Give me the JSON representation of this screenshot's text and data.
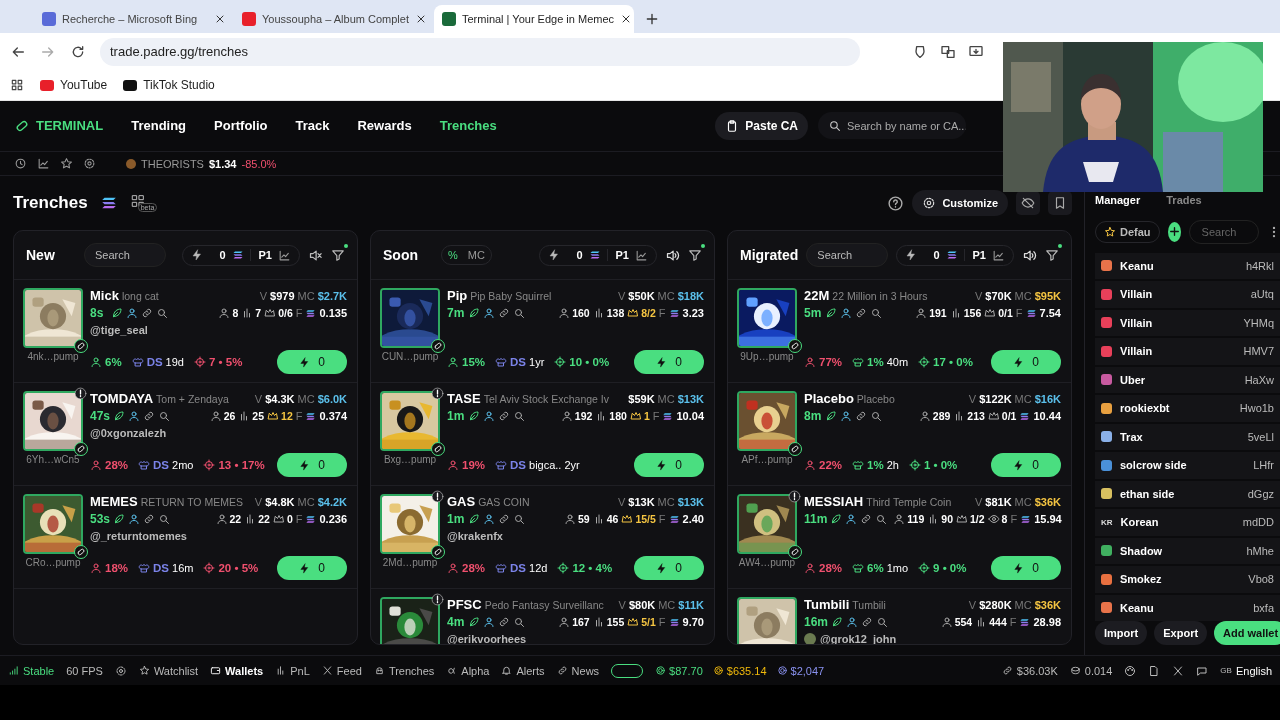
{
  "browser": {
    "tabs": [
      {
        "title": "Recherche – Microsoft Bing",
        "selected": false
      },
      {
        "title": "Youssoupha – Album Complet",
        "selected": false
      },
      {
        "title": "Terminal | Your Edge in Memec",
        "selected": true
      }
    ],
    "url": "trade.padre.gg/trenches",
    "bookmarks": [
      "YouTube",
      "TikTok Studio"
    ]
  },
  "nav": {
    "logo": "TERMINAL",
    "items": [
      {
        "label": "Trending",
        "selected": false
      },
      {
        "label": "Portfolio",
        "selected": false
      },
      {
        "label": "Track",
        "selected": false
      },
      {
        "label": "Rewards",
        "selected": false
      },
      {
        "label": "Trenches",
        "selected": true
      }
    ],
    "paste_button": "Paste CA",
    "search": {
      "placeholder": "Search by name or CA..."
    }
  },
  "ticker": {
    "symbol": "THEORISTS",
    "price": "$1.34",
    "change": "-85.0%"
  },
  "header": {
    "title": "Trenches",
    "badge": "beta",
    "customize": "Customize"
  },
  "columns": [
    {
      "title": "New",
      "search": {
        "placeholder": "Search"
      },
      "amount": "0",
      "preset": "P1",
      "muted": true,
      "cards": [
        {
          "ticker": "Mick",
          "name": "long cat",
          "address": "4nk…pump",
          "age": "8s",
          "volume": {
            "label": "V",
            "value": "$979"
          },
          "mc": {
            "label": "MC",
            "value": "$2.7K",
            "color": "#5bc0eb"
          },
          "holders": "8",
          "txns": "7",
          "top": {
            "value": "0/6",
            "highlight": false
          },
          "f": {
            "label": "F",
            "value": "0.135"
          },
          "handle": "@tige_seal",
          "warning": false,
          "metrics": [
            {
              "kind": "holders",
              "label": "6%",
              "color": "#4ade80"
            },
            {
              "kind": "dev",
              "label": "DS",
              "text": "19d",
              "color": "#7b83e8"
            },
            {
              "kind": "target",
              "label": "7 • 5%",
              "color": "#f0506e"
            }
          ],
          "buy": "0"
        },
        {
          "ticker": "TOMDAYA",
          "name": "Tom + Zendaya",
          "address": "6Yh…wCn5",
          "age": "47s",
          "volume": {
            "label": "V",
            "value": "$4.3K"
          },
          "mc": {
            "label": "MC",
            "value": "$6.0K",
            "color": "#5bc0eb"
          },
          "holders": "26",
          "txns": "25",
          "top": {
            "value": "12",
            "highlight": true
          },
          "f": {
            "label": "F",
            "value": "0.374"
          },
          "handle": "@0xgonzalezh",
          "warning": true,
          "metrics": [
            {
              "kind": "holders",
              "label": "28%",
              "color": "#f0506e"
            },
            {
              "kind": "dev",
              "label": "DS",
              "text": "2mo",
              "color": "#7b83e8"
            },
            {
              "kind": "target",
              "label": "13 • 17%",
              "color": "#f0506e"
            }
          ],
          "buy": "0"
        },
        {
          "ticker": "MEMES",
          "name": "RETURN TO MEMES",
          "address": "CRo…pump",
          "age": "53s",
          "volume": {
            "label": "V",
            "value": "$4.8K"
          },
          "mc": {
            "label": "MC",
            "value": "$4.2K",
            "color": "#5bc0eb"
          },
          "holders": "22",
          "txns": "22",
          "top": {
            "value": "0",
            "highlight": false
          },
          "f": {
            "label": "F",
            "value": "0.236"
          },
          "handle": "@_returntomemes",
          "warning": false,
          "metrics": [
            {
              "kind": "holders",
              "label": "18%",
              "color": "#f0506e"
            },
            {
              "kind": "dev",
              "label": "DS",
              "text": "16m",
              "color": "#7b83e8"
            },
            {
              "kind": "target",
              "label": "20 • 5%",
              "color": "#f0506e"
            }
          ],
          "buy": "0"
        }
      ]
    },
    {
      "title": "Soon",
      "sort": [
        {
          "label": "%",
          "selected": true
        },
        {
          "label": "MC",
          "selected": false
        }
      ],
      "amount": "0",
      "preset": "P1",
      "muted": false,
      "cards": [
        {
          "ticker": "Pip",
          "name": "Pip Baby Squirrel",
          "address": "CUN…pump",
          "age": "7m",
          "volume": {
            "label": "V",
            "value": "$50K"
          },
          "mc": {
            "label": "MC",
            "value": "$18K",
            "color": "#5bc0eb"
          },
          "holders": "160",
          "txns": "138",
          "top": {
            "value": "8/2",
            "highlight": true
          },
          "f": {
            "label": "F",
            "value": "3.23"
          },
          "warning": false,
          "metrics": [
            {
              "kind": "holders",
              "label": "15%",
              "color": "#4ade80"
            },
            {
              "kind": "dev",
              "label": "DS",
              "text": "1yr",
              "color": "#7b83e8"
            },
            {
              "kind": "target",
              "label": "10 • 0%",
              "color": "#4ade80"
            }
          ],
          "buy": "0"
        },
        {
          "ticker": "TASE",
          "name": "Tel Aviv Stock Exchange Iv",
          "address": "Bxg…pump",
          "age": "1m",
          "volume": {
            "value": "$59K"
          },
          "mc": {
            "label": "MC",
            "value": "$13K",
            "color": "#5bc0eb"
          },
          "holders": "192",
          "txns": "180",
          "top": {
            "value": "1",
            "highlight": true
          },
          "f": {
            "label": "F",
            "value": "10.04"
          },
          "warning": true,
          "metrics": [
            {
              "kind": "holders",
              "label": "19%",
              "color": "#f0506e"
            },
            {
              "kind": "dev",
              "label": "DS",
              "text": "bigca.. 2yr",
              "color": "#7b83e8"
            }
          ],
          "buy": "0"
        },
        {
          "ticker": "GAS",
          "name": "GAS COIN",
          "address": "2Md…pump",
          "age": "1m",
          "volume": {
            "label": "V",
            "value": "$13K"
          },
          "mc": {
            "label": "MC",
            "value": "$13K",
            "color": "#5bc0eb"
          },
          "holders": "59",
          "txns": "46",
          "top": {
            "value": "15/5",
            "highlight": true
          },
          "f": {
            "label": "F",
            "value": "2.40"
          },
          "handle": "@krakenfx",
          "warning": true,
          "metrics": [
            {
              "kind": "holders",
              "label": "28%",
              "color": "#f0506e"
            },
            {
              "kind": "dev",
              "label": "DS",
              "text": "12d",
              "color": "#7b83e8"
            },
            {
              "kind": "target",
              "label": "12 • 4%",
              "color": "#4ade80"
            }
          ],
          "buy": "0"
        },
        {
          "ticker": "PFSC",
          "name": "Pedo Fantasy Surveillanc",
          "age": "4m",
          "volume": {
            "label": "V",
            "value": "$80K"
          },
          "mc": {
            "label": "MC",
            "value": "$11K",
            "color": "#5bc0eb"
          },
          "holders": "167",
          "txns": "155",
          "top": {
            "value": "5/1",
            "highlight": true
          },
          "f": {
            "label": "F",
            "value": "9.70"
          },
          "handle": "@erikvoorhees",
          "warning": true
        }
      ]
    },
    {
      "title": "Migrated",
      "search": {
        "placeholder": "Search"
      },
      "amount": "0",
      "preset": "P1",
      "muted": false,
      "cards": [
        {
          "ticker": "22M",
          "name": "22 Million in 3 Hours",
          "address": "9Up…pump",
          "age": "5m",
          "volume": {
            "label": "V",
            "value": "$70K"
          },
          "mc": {
            "label": "MC",
            "value": "$95K",
            "color": "#f5c542"
          },
          "holders": "191",
          "txns": "156",
          "top": {
            "value": "0/1",
            "highlight": false
          },
          "f": {
            "label": "F",
            "value": "7.54"
          },
          "warning": false,
          "metrics": [
            {
              "kind": "holders",
              "label": "77%",
              "color": "#f0506e"
            },
            {
              "kind": "dev",
              "label": "1%",
              "text": "40m",
              "color": "#4ade80"
            },
            {
              "kind": "target",
              "label": "17 • 0%",
              "color": "#4ade80"
            }
          ],
          "buy": "0"
        },
        {
          "ticker": "Placebo",
          "name": "Placebo",
          "address": "APf…pump",
          "age": "8m",
          "volume": {
            "label": "V",
            "value": "$122K"
          },
          "mc": {
            "label": "MC",
            "value": "$16K",
            "color": "#5bc0eb"
          },
          "holders": "289",
          "txns": "213",
          "top": {
            "value": "0/1",
            "highlight": false
          },
          "f": {
            "value": "10.44"
          },
          "warning": false,
          "metrics": [
            {
              "kind": "holders",
              "label": "22%",
              "color": "#f0506e"
            },
            {
              "kind": "dev",
              "label": "1%",
              "text": "2h",
              "color": "#4ade80"
            },
            {
              "kind": "target",
              "label": "1 • 0%",
              "color": "#4ade80"
            }
          ],
          "buy": "0"
        },
        {
          "ticker": "MESSIAH",
          "name": "Third Temple Coin",
          "address": "AW4…pump",
          "age": "11m",
          "volume": {
            "label": "V",
            "value": "$81K"
          },
          "mc": {
            "label": "MC",
            "value": "$36K",
            "color": "#f5c542"
          },
          "holders": "119",
          "txns": "90",
          "top": {
            "value": "1/2",
            "highlight": false
          },
          "watchers": "8",
          "f": {
            "label": "F",
            "value": "15.94"
          },
          "warning": true,
          "metrics": [
            {
              "kind": "holders",
              "label": "28%",
              "color": "#f0506e"
            },
            {
              "kind": "dev",
              "label": "6%",
              "text": "1mo",
              "color": "#4ade80"
            },
            {
              "kind": "target",
              "label": "9 • 0%",
              "color": "#4ade80"
            }
          ],
          "buy": "0"
        },
        {
          "ticker": "Tumbili",
          "name": "Tumbili",
          "age": "16m",
          "volume": {
            "label": "V",
            "value": "$280K"
          },
          "mc": {
            "label": "MC",
            "value": "$36K",
            "color": "#f5c542"
          },
          "holders": "554",
          "txns": "444",
          "f": {
            "label": "F",
            "value": "28.98"
          },
          "handle": "@grok12_john",
          "warning": false
        }
      ]
    }
  ],
  "wallet_panel": {
    "tabs": [
      {
        "label": "Manager",
        "selected": true
      },
      {
        "label": "Trades",
        "selected": false
      }
    ],
    "group": "Defau",
    "search": {
      "placeholder": "Search"
    },
    "wallets": [
      {
        "name": "Keanu",
        "address": "h4Rkl",
        "color": "#e8734a"
      },
      {
        "name": "Villain",
        "address": "aUtq",
        "color": "#e8405a"
      },
      {
        "name": "Villain",
        "address": "YHMq",
        "color": "#e8405a"
      },
      {
        "name": "Villain",
        "address": "HMV7",
        "color": "#e8405a"
      },
      {
        "name": "Uber",
        "address": "HaXw",
        "color": "#c85aa0"
      },
      {
        "name": "rookiexbt",
        "address": "Hwo1b",
        "color": "#e8a040"
      },
      {
        "name": "Trax",
        "address": "5veLl",
        "color": "#8ab0e8"
      },
      {
        "name": "solcrow side",
        "address": "LHfr",
        "color": "#4a90d8"
      },
      {
        "name": "ethan side",
        "address": "dGgz",
        "color": "#d8c060"
      },
      {
        "name": "Korean",
        "address": "mdDD",
        "badge": "KR"
      },
      {
        "name": "Shadow",
        "address": "hMhe",
        "color": "#40b060"
      },
      {
        "name": "Smokez",
        "address": "Vbo8",
        "color": "#e87040"
      },
      {
        "name": "Keanu",
        "address": "bxfa",
        "color": "#e8734a"
      }
    ],
    "buttons": [
      {
        "label": "Import",
        "primary": false
      },
      {
        "label": "Export",
        "primary": false
      },
      {
        "label": "Add wallet",
        "primary": true
      }
    ]
  },
  "status_bar": {
    "connection": "Stable",
    "fps": "60 FPS",
    "tabs": [
      {
        "label": "Watchlist",
        "selected": false
      },
      {
        "label": "Wallets",
        "selected": true
      },
      {
        "label": "PnL",
        "selected": false
      },
      {
        "label": "Feed",
        "selected": false
      },
      {
        "label": "Trenches",
        "selected": false
      },
      {
        "label": "Alpha",
        "selected": false
      },
      {
        "label": "Alerts",
        "selected": false
      },
      {
        "label": "News",
        "selected": false
      }
    ],
    "prices": [
      {
        "value": "$87.70",
        "color": "#4ade80"
      },
      {
        "value": "$635.14",
        "color": "#f0b90b"
      },
      {
        "value": "$2,047",
        "color": "#8a92f0"
      }
    ],
    "market_cap": "$36.03K",
    "gas": "0.014",
    "region": "GB",
    "language": "English"
  }
}
